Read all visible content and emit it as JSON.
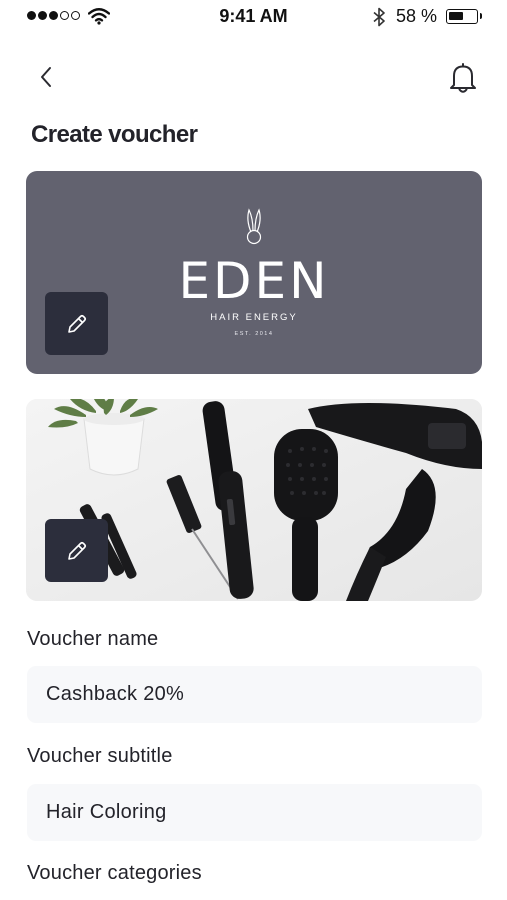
{
  "status_bar": {
    "time": "9:41 AM",
    "battery_percent": "58 %",
    "battery_level": 0.58,
    "signal_bars_filled": 3,
    "signal_bars_total": 5,
    "icons": [
      "signal-dots-icon",
      "wifi-icon",
      "bluetooth-icon",
      "battery-icon"
    ]
  },
  "nav": {
    "back_icon": "chevron-left-icon",
    "notifications_icon": "bell-icon"
  },
  "page": {
    "title": "Create voucher"
  },
  "logo_card": {
    "background_color": "#62626f",
    "brand_name": "EDEN",
    "tagline": "HAIR ENERGY",
    "established": "EST. 2014",
    "edit_icon": "pencil-icon"
  },
  "cover_card": {
    "description_icon": "cover-photo",
    "edit_icon": "pencil-icon"
  },
  "form": {
    "voucher_name": {
      "label": "Voucher name",
      "value": "Cashback 20%"
    },
    "voucher_subtitle": {
      "label": "Voucher subtitle",
      "value": "Hair Coloring"
    },
    "voucher_categories": {
      "label": "Voucher categories"
    }
  },
  "colors": {
    "edit_button": "#2c2e3c",
    "input_background": "#f7f8fa",
    "text": "#23232a"
  }
}
